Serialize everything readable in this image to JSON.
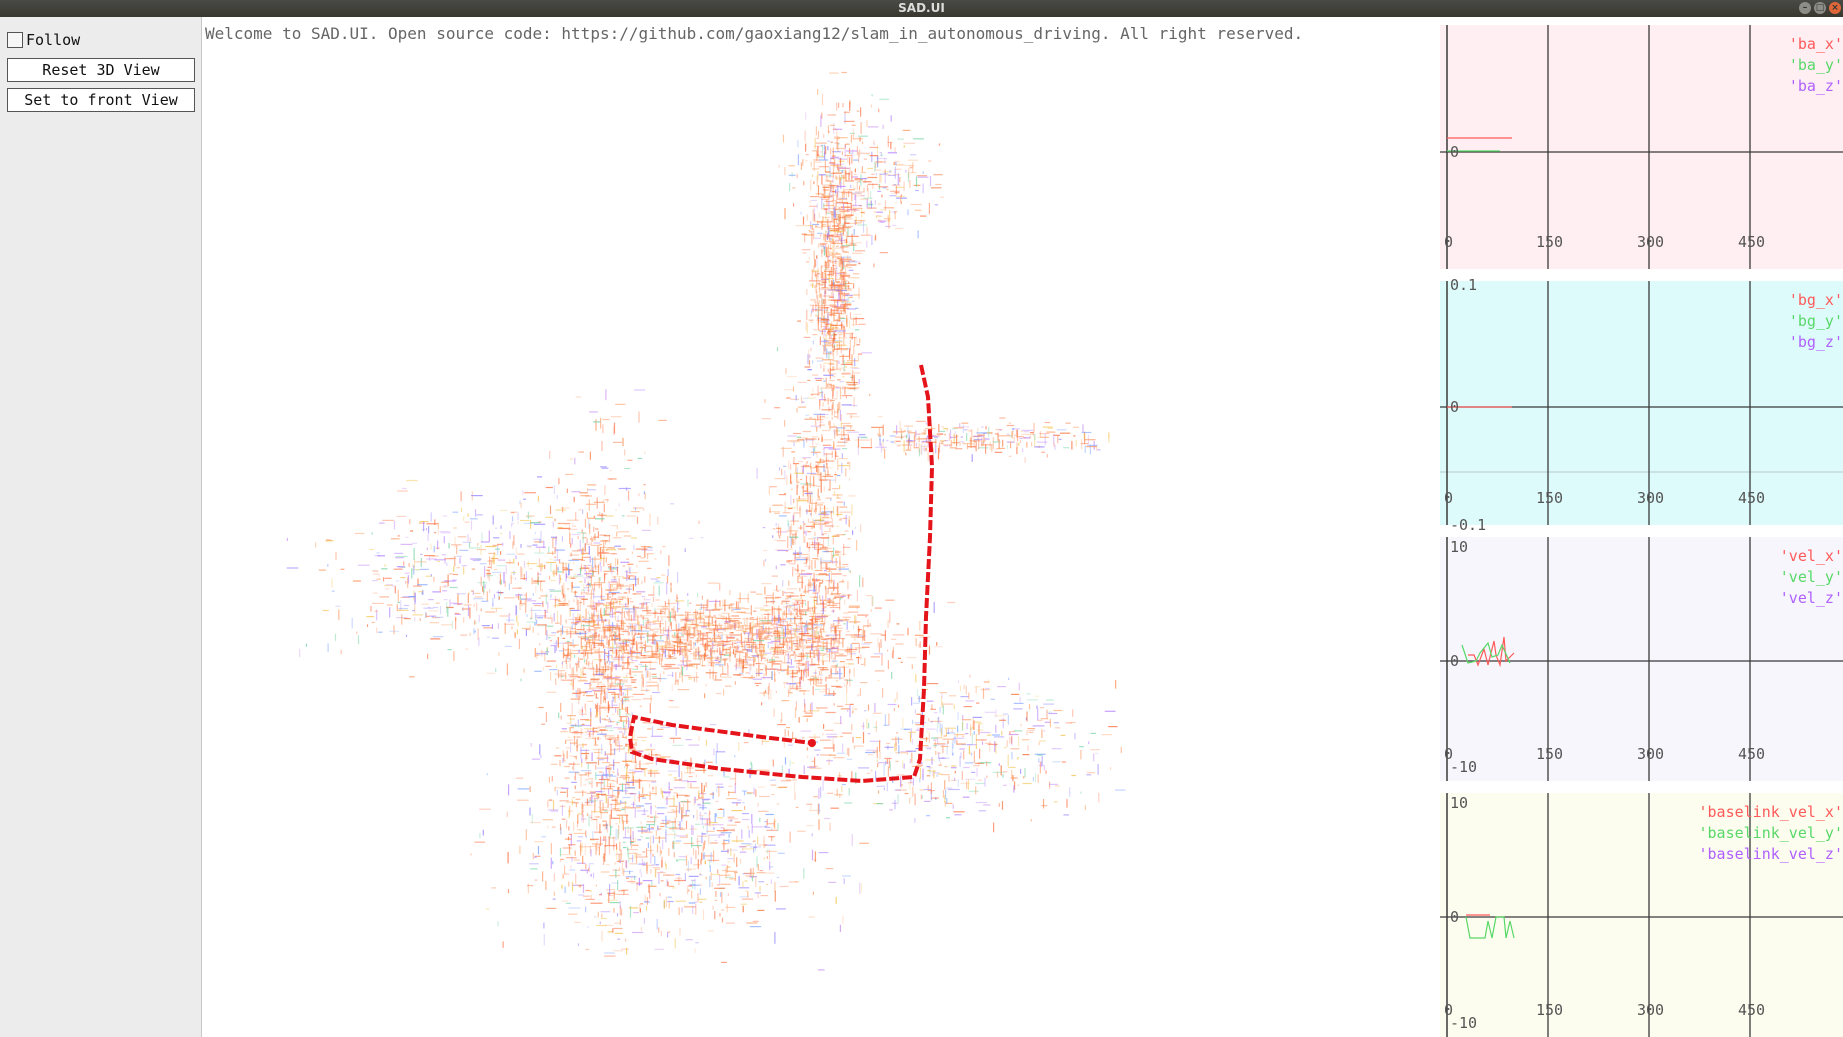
{
  "window": {
    "title": "SAD.UI"
  },
  "sidebar": {
    "follow_label": "Follow",
    "follow_checked": false,
    "reset_label": "Reset 3D View",
    "front_label": "Set to front View"
  },
  "viewport": {
    "welcome_text": "Welcome to SAD.UI. Open source code: https://github.com/gaoxiang12/slam_in_autonomous_driving. All right reserved."
  },
  "plots": [
    {
      "id": "ba",
      "bg": "#ffeef2",
      "y_labels": [
        "0"
      ],
      "x_labels": [
        "0",
        "150",
        "300",
        "450"
      ],
      "legend": [
        {
          "label": "'ba_x'",
          "color": "#ff5a5a"
        },
        {
          "label": "'ba_y'",
          "color": "#58d868"
        },
        {
          "label": "'ba_z'",
          "color": "#b060ff"
        }
      ]
    },
    {
      "id": "bg",
      "bg": "#ddfbfb",
      "y_labels": [
        "0.1",
        "0",
        "-0.1"
      ],
      "x_labels": [
        "0",
        "150",
        "300",
        "450"
      ],
      "legend": [
        {
          "label": "'bg_x'",
          "color": "#ff5a5a"
        },
        {
          "label": "'bg_y'",
          "color": "#58d868"
        },
        {
          "label": "'bg_z'",
          "color": "#b060ff"
        }
      ]
    },
    {
      "id": "vel",
      "bg": "#f6f6fc",
      "y_labels": [
        "10",
        "0",
        "-10"
      ],
      "x_labels": [
        "0",
        "150",
        "300",
        "450"
      ],
      "legend": [
        {
          "label": "'vel_x'",
          "color": "#ff5a5a"
        },
        {
          "label": "'vel_y'",
          "color": "#58d868"
        },
        {
          "label": "'vel_z'",
          "color": "#b060ff"
        }
      ]
    },
    {
      "id": "baselink",
      "bg": "#fdfdef",
      "y_labels": [
        "10",
        "0",
        "-10"
      ],
      "x_labels": [
        "0",
        "150",
        "300",
        "450"
      ],
      "legend": [
        {
          "label": "'baselink_vel_x'",
          "color": "#ff5a5a"
        },
        {
          "label": "'baselink_vel_y'",
          "color": "#58d868"
        },
        {
          "label": "'baselink_vel_z'",
          "color": "#b060ff"
        }
      ]
    }
  ]
}
